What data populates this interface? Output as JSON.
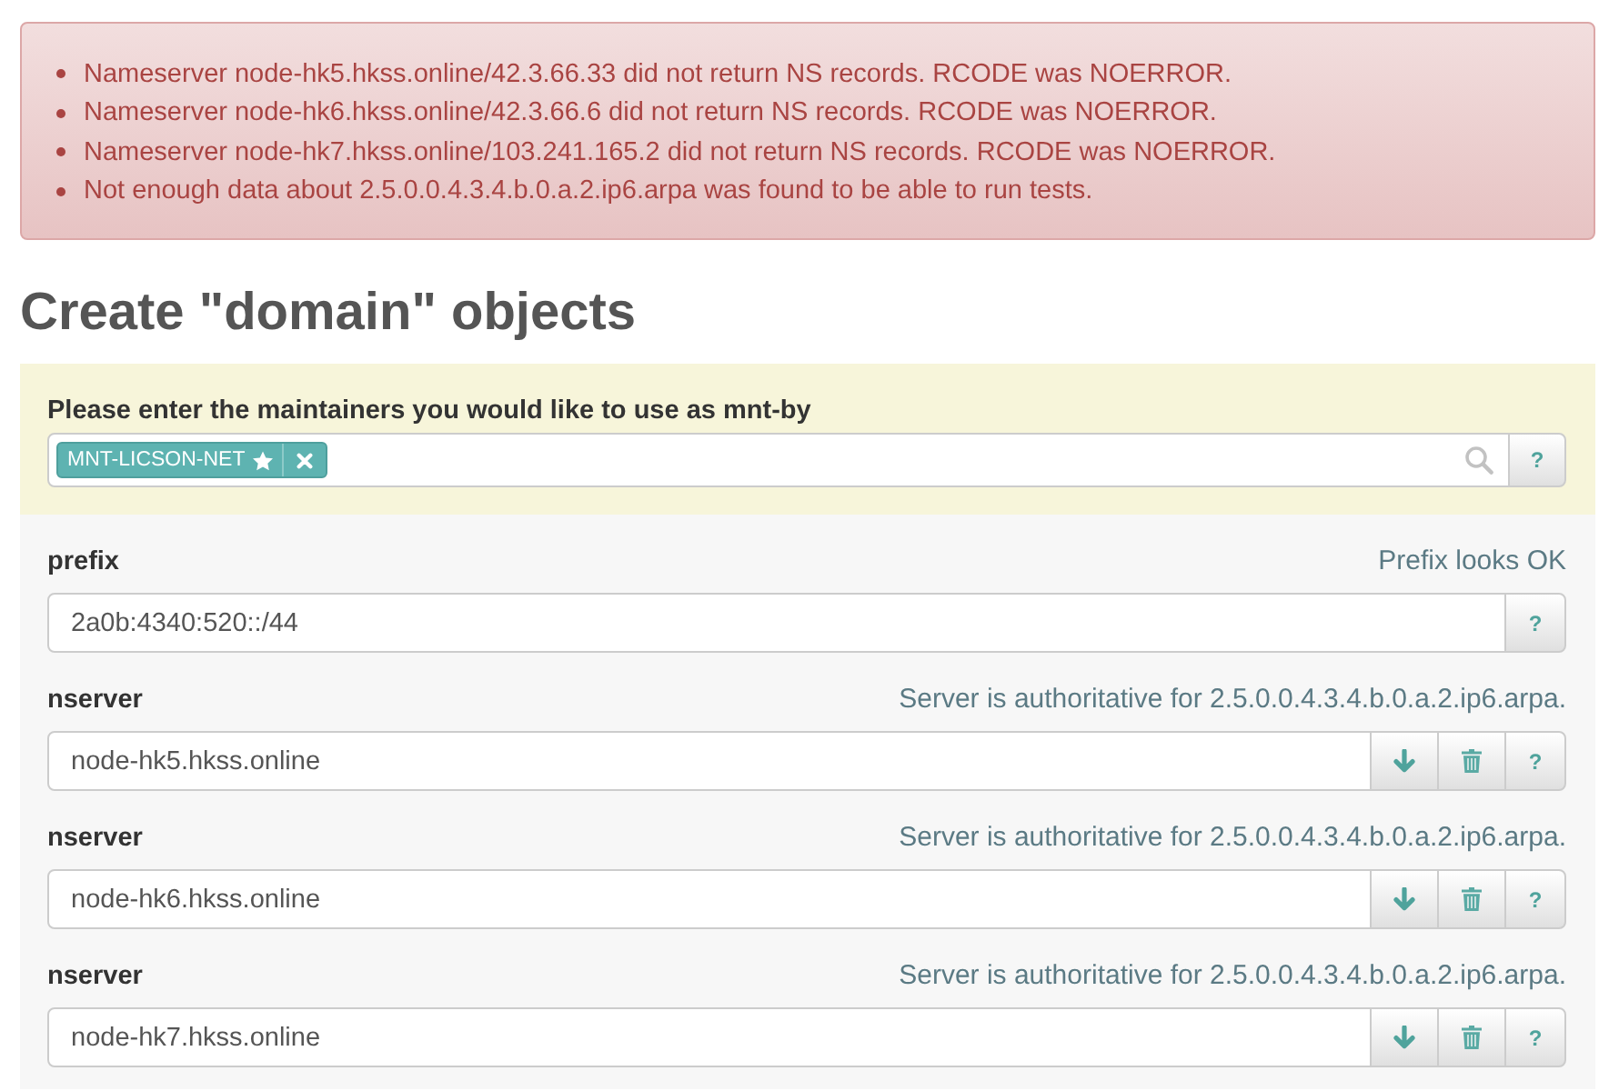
{
  "alert": {
    "messages": [
      "Nameserver node-hk5.hkss.online/42.3.66.33 did not return NS records. RCODE was NOERROR.",
      "Nameserver node-hk6.hkss.online/42.3.66.6 did not return NS records. RCODE was NOERROR.",
      "Nameserver node-hk7.hkss.online/103.241.165.2 did not return NS records. RCODE was NOERROR.",
      "Not enough data about 2.5.0.0.4.3.4.b.0.a.2.ip6.arpa was found to be able to run tests."
    ]
  },
  "heading": "Create \"domain\" objects",
  "maintainers": {
    "label": "Please enter the maintainers you would like to use as mnt-by",
    "tags": [
      {
        "text": "MNT-LICSON-NET"
      }
    ],
    "help": "?"
  },
  "fields": [
    {
      "kind": "single",
      "label": "prefix",
      "status": "Prefix looks OK",
      "value": "2a0b:4340:520::/44",
      "help": "?"
    },
    {
      "kind": "repeatable",
      "label": "nserver",
      "status": "Server is authoritative for 2.5.0.0.4.3.4.b.0.a.2.ip6.arpa.",
      "value": "node-hk5.hkss.online",
      "help": "?"
    },
    {
      "kind": "repeatable",
      "label": "nserver",
      "status": "Server is authoritative for 2.5.0.0.4.3.4.b.0.a.2.ip6.arpa.",
      "value": "node-hk6.hkss.online",
      "help": "?"
    },
    {
      "kind": "repeatable",
      "label": "nserver",
      "status": "Server is authoritative for 2.5.0.0.4.3.4.b.0.a.2.ip6.arpa.",
      "value": "node-hk7.hkss.online",
      "help": "?"
    }
  ]
}
